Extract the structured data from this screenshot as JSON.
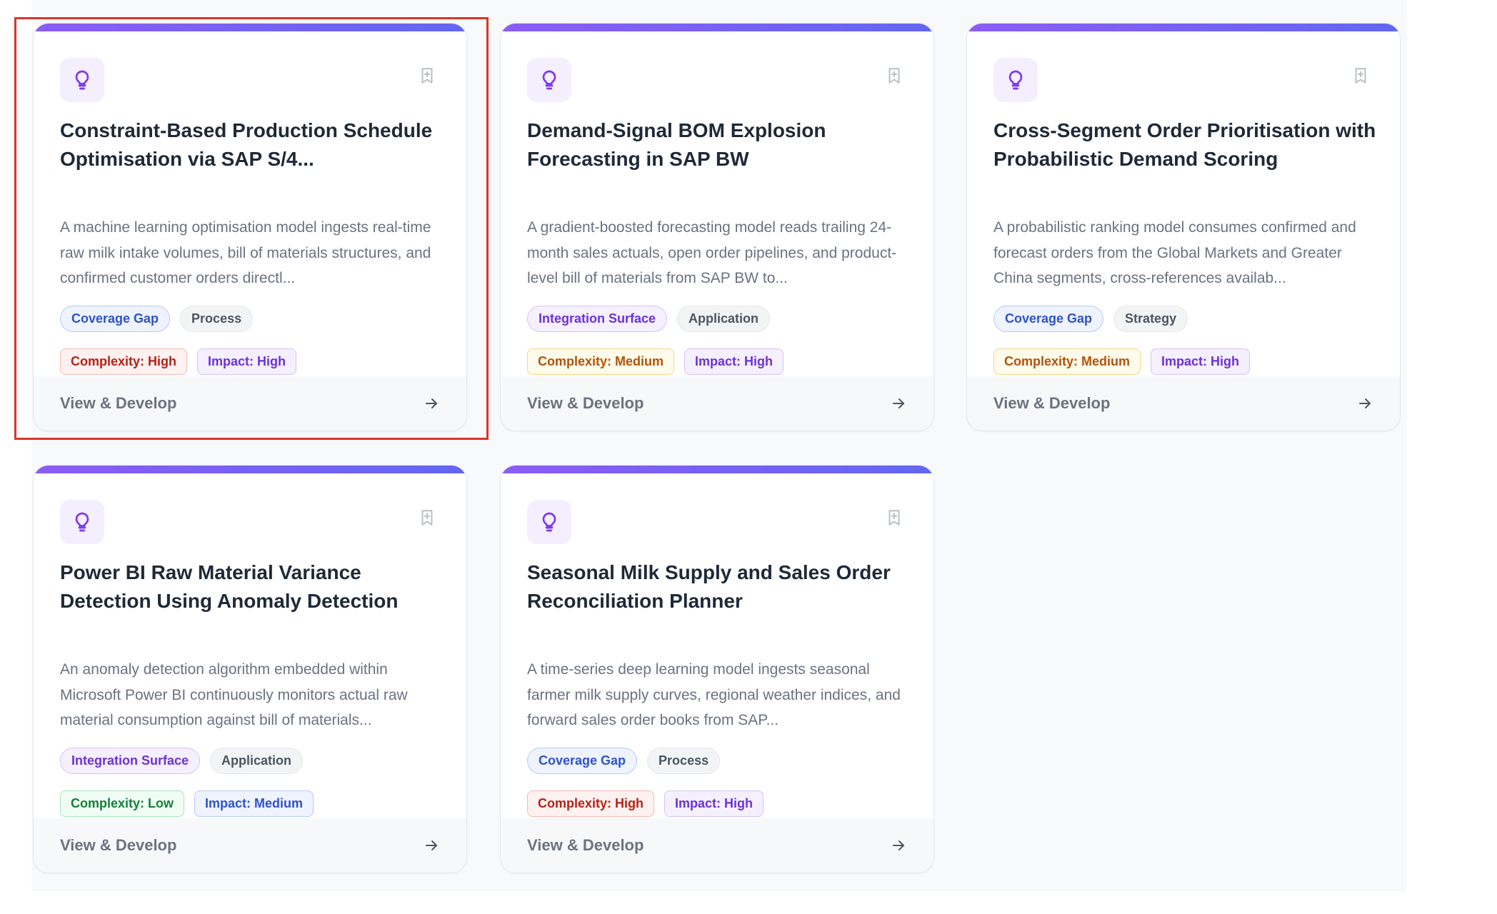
{
  "colors": {
    "accent_bar_start": "#8b5cf6",
    "accent_bar_end": "#6366f1",
    "icon_tint": "#7c3aed",
    "selection_outline": "#d9342b"
  },
  "icons": {
    "card_icon": "lightbulb-icon",
    "save_icon": "bookmark-plus-icon",
    "footer_icon": "arrow-right-icon"
  },
  "cards": [
    {
      "title": "Constraint-Based Production Schedule Optimisation via SAP S/4...",
      "description": "A machine learning optimisation model ingests real-time raw milk intake volumes, bill of materials structures, and confirmed customer orders directl...",
      "tags": [
        "Coverage Gap",
        "Process"
      ],
      "complexity": "Complexity: High",
      "impact": "Impact: High",
      "footer": "View & Develop",
      "selected": true
    },
    {
      "title": "Demand-Signal BOM Explosion Forecasting in SAP BW",
      "description": "A gradient-boosted forecasting model reads trailing 24-month sales actuals, open order pipelines, and product-level bill of materials from SAP BW to...",
      "tags": [
        "Integration Surface",
        "Application"
      ],
      "complexity": "Complexity: Medium",
      "impact": "Impact: High",
      "footer": "View & Develop",
      "selected": false
    },
    {
      "title": "Cross-Segment Order Prioritisation with Probabilistic Demand Scoring",
      "description": "A probabilistic ranking model consumes confirmed and forecast orders from the Global Markets and Greater China segments, cross-references availab...",
      "tags": [
        "Coverage Gap",
        "Strategy"
      ],
      "complexity": "Complexity: Medium",
      "impact": "Impact: High",
      "footer": "View & Develop",
      "selected": false
    },
    {
      "title": "Power BI Raw Material Variance Detection Using Anomaly Detection",
      "description": "An anomaly detection algorithm embedded within Microsoft Power BI continuously monitors actual raw material consumption against bill of materials...",
      "tags": [
        "Integration Surface",
        "Application"
      ],
      "complexity": "Complexity: Low",
      "impact": "Impact: Medium",
      "footer": "View & Develop",
      "selected": false
    },
    {
      "title": "Seasonal Milk Supply and Sales Order Reconciliation Planner",
      "description": "A time-series deep learning model ingests seasonal farmer milk supply curves, regional weather indices, and forward sales order books from SAP...",
      "tags": [
        "Coverage Gap",
        "Process"
      ],
      "complexity": "Complexity: High",
      "impact": "Impact: High",
      "footer": "View & Develop",
      "selected": false
    }
  ]
}
